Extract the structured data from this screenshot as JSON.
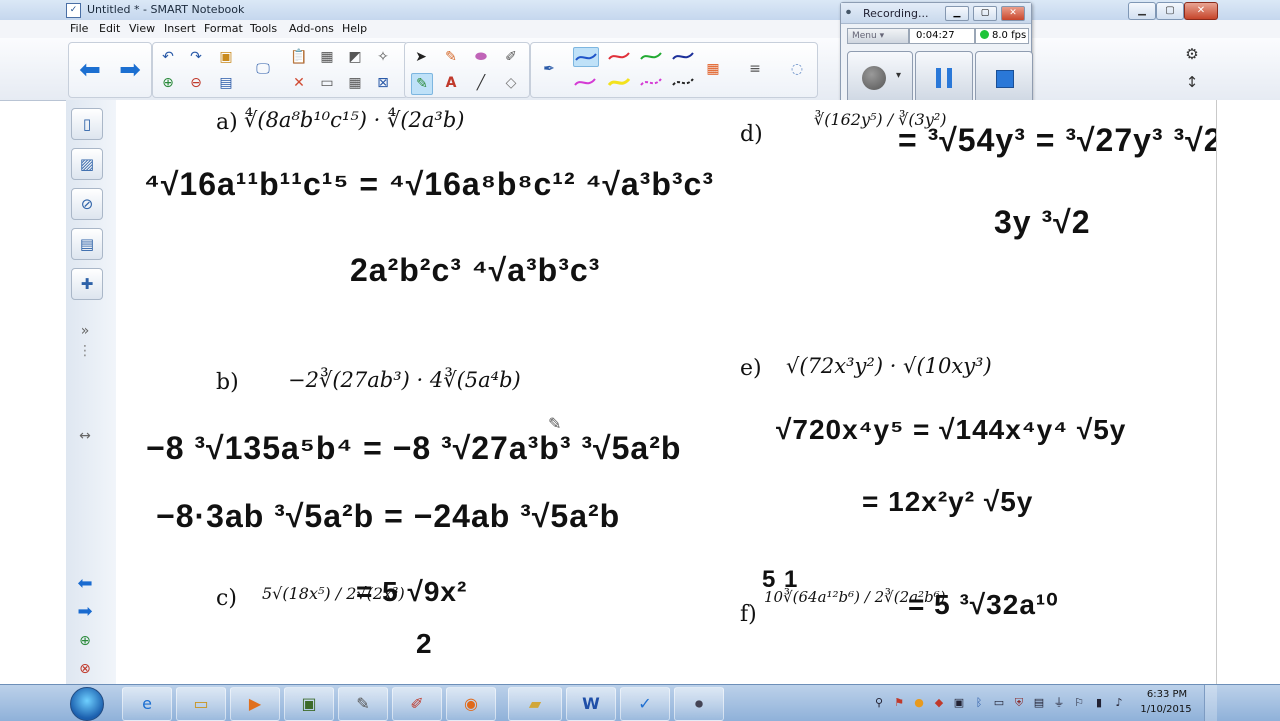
{
  "window": {
    "title": "Untitled * - SMART Notebook"
  },
  "menu": [
    "File",
    "Edit",
    "View",
    "Insert",
    "Format",
    "Tools",
    "Add-ons",
    "Help"
  ],
  "toolbar": {
    "icons": [
      "back-arrow",
      "forward-arrow",
      "undo",
      "redo",
      "paste",
      "screen-shade",
      "delete",
      "table",
      "pointer",
      "pen",
      "eraser",
      "line",
      "text",
      "fill",
      "properties"
    ]
  },
  "recording": {
    "title": "Recording...",
    "menu_label": "Menu",
    "elapsed": "0:04:27",
    "fps": "8.0 fps",
    "status_color": "#1fc43a"
  },
  "canvas": {
    "problems": [
      {
        "label": "a)",
        "expr": "∜(8a⁸b¹⁰c¹⁵) · ∜(2a³b)"
      },
      {
        "label": "b)",
        "expr": "−2∛(27ab³) · 4∛(5a⁴b)"
      },
      {
        "label": "c)",
        "expr": "5√(18x⁵) / 2√(2x³)"
      },
      {
        "label": "d)",
        "expr": "∛(162y⁵) / ∛(3y²)"
      },
      {
        "label": "e)",
        "expr": "√(72x³y²) · √(10xy³)"
      },
      {
        "label": "f)",
        "expr": "10∛(64a¹²b⁶) / 2∛(2a²b⁶)"
      }
    ],
    "work": {
      "a_line1": "⁴√16a¹¹b¹¹c¹⁵  =  ⁴√16a⁸b⁸c¹²  ⁴√a³b³c³",
      "a_line2": "2a²b²c³  ⁴√a³b³c³",
      "b_line1": "−8 ³√135a⁵b⁴  = −8  ³√27a³b³  ³√5a²b",
      "b_line2": "−8·3ab  ³√5a²b  =  −24ab  ³√5a²b",
      "c_line1": "= 5 √9x²",
      "c_line2": "2",
      "d_line1": "= ³√54y³ = ³√27y³  ³√2",
      "d_line2": "3y ³√2",
      "e_line1": "√720x⁴y⁵ = √144x⁴y⁴ √5y",
      "e_line2": "= 12x²y² √5y",
      "f_line1": "= 5 ³√32a¹⁰",
      "f_marks": "5 1"
    }
  },
  "taskbar": {
    "apps": [
      "internet-explorer",
      "file-explorer",
      "media-player",
      "minecraft",
      "notepad-app",
      "paint",
      "firefox",
      "folder",
      "word",
      "smart-notebook",
      "recorder"
    ],
    "time": "6:33 PM",
    "date": "1/10/2015"
  }
}
